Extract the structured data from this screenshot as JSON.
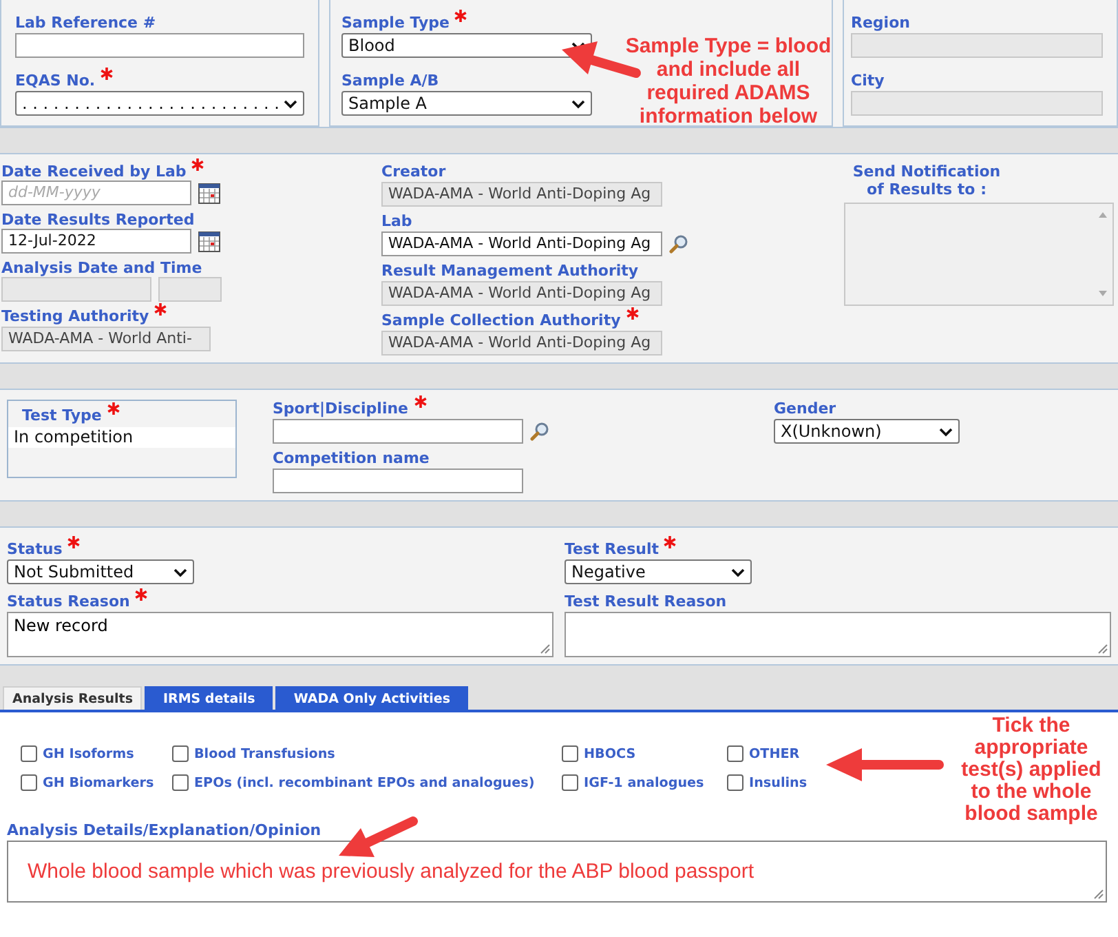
{
  "sections": [
    {
      "kind": "panels",
      "columns": [
        [
          {
            "kind": "text",
            "label": "Lab Reference #",
            "required": false,
            "disabled": false
          },
          {
            "kind": "select",
            "label": "EQAS No.",
            "required": true,
            "disabled": false,
            "value": ". . . . . . . . . . . . . . . . . . . . . . . . ."
          }
        ],
        [
          {
            "kind": "select",
            "label": "Sample Type",
            "required": true,
            "disabled": false,
            "value": "Blood"
          },
          {
            "kind": "select",
            "label": "Sample A/B",
            "required": false,
            "disabled": false,
            "value": "Sample A"
          }
        ],
        [
          {
            "kind": "text",
            "label": "Region",
            "required": false,
            "disabled": true
          },
          {
            "kind": "text",
            "label": "City",
            "required": false,
            "disabled": true
          }
        ]
      ]
    },
    {
      "kind": "plain",
      "columns": [
        [
          {
            "kind": "date",
            "label": "Date Received by Lab",
            "required": true,
            "disabled": false,
            "placeholder": "dd-MM-yyyy"
          },
          {
            "kind": "date",
            "label": "Date Results Reported",
            "required": false,
            "disabled": false,
            "value": "12-Jul-2022"
          },
          {
            "kind": "pair",
            "label": "Analysis Date and Time",
            "required": false,
            "disabled": true
          },
          {
            "kind": "text",
            "label": "Testing Authority",
            "required": true,
            "disabled": true,
            "value": "WADA-AMA - World Anti-"
          }
        ],
        [
          {
            "kind": "text",
            "label": "Creator",
            "required": false,
            "disabled": true,
            "value": "WADA-AMA - World Anti-Doping Ag"
          },
          {
            "kind": "lookup",
            "label": "Lab",
            "required": false,
            "disabled": false,
            "value": "WADA-AMA - World Anti-Doping Ag"
          },
          {
            "kind": "text",
            "label": "Result Management Authority",
            "required": false,
            "disabled": true,
            "value": "WADA-AMA - World Anti-Doping Ag"
          },
          {
            "kind": "text",
            "label": "Sample Collection Authority",
            "required": true,
            "disabled": true,
            "value": "WADA-AMA - World Anti-Doping Ag"
          }
        ],
        [
          {
            "kind": "textarea",
            "label": "Send Notification of Results to :",
            "required": false,
            "disabled": true
          }
        ]
      ]
    },
    {
      "kind": "plain",
      "columns": [
        [
          {
            "kind": "listbox",
            "label": "Test Type",
            "required": true,
            "disabled": false,
            "options": [
              {
                "label": "In competition",
                "selected": true
              }
            ]
          }
        ],
        [
          {
            "kind": "lookup",
            "label": "Sport|Discipline",
            "required": true,
            "disabled": false
          },
          {
            "kind": "text",
            "label": "Competition name",
            "required": false,
            "disabled": false
          }
        ],
        [
          {
            "kind": "select",
            "label": "Gender",
            "required": false,
            "disabled": false,
            "value": "X(Unknown)"
          }
        ]
      ]
    },
    {
      "kind": "plain",
      "columns": [
        [
          {
            "kind": "select",
            "label": "Status",
            "required": true,
            "disabled": false,
            "value": "Not Submitted"
          },
          {
            "kind": "textarea",
            "label": "Status Reason",
            "required": true,
            "disabled": false,
            "value": "New record"
          }
        ],
        [
          {
            "kind": "select",
            "label": "Test Result",
            "required": true,
            "disabled": false,
            "value": "Negative"
          },
          {
            "kind": "textarea",
            "label": "Test Result Reason",
            "required": false,
            "disabled": false
          }
        ]
      ]
    }
  ],
  "tabs": [
    {
      "label": "Analysis Results",
      "selected": true
    },
    {
      "label": "IRMS details",
      "selected": false
    },
    {
      "label": "WADA Only Activities",
      "selected": false
    }
  ],
  "tests": [
    {
      "label": "GH Isoforms",
      "checked": false
    },
    {
      "label": "Blood Transfusions",
      "checked": false
    },
    {
      "label": "HBOCS",
      "checked": false
    },
    {
      "label": "OTHER",
      "checked": false
    },
    {
      "label": "GH Biomarkers",
      "checked": false
    },
    {
      "label": "EPOs (incl. recombinant EPOs and analogues)",
      "checked": false
    },
    {
      "label": "IGF-1 analogues",
      "checked": false
    },
    {
      "label": "Insulins",
      "checked": false
    }
  ],
  "analysis_details": {
    "label": "Analysis Details/Explanation/Opinion",
    "value": "Whole blood sample which was previously analyzed for the ABP blood passport"
  },
  "annotations": [
    {
      "text": "Sample Type = blood and include all required ADAMS information below"
    },
    {
      "text": "Tick the appropriate test(s) applied to the whole blood sample"
    }
  ]
}
